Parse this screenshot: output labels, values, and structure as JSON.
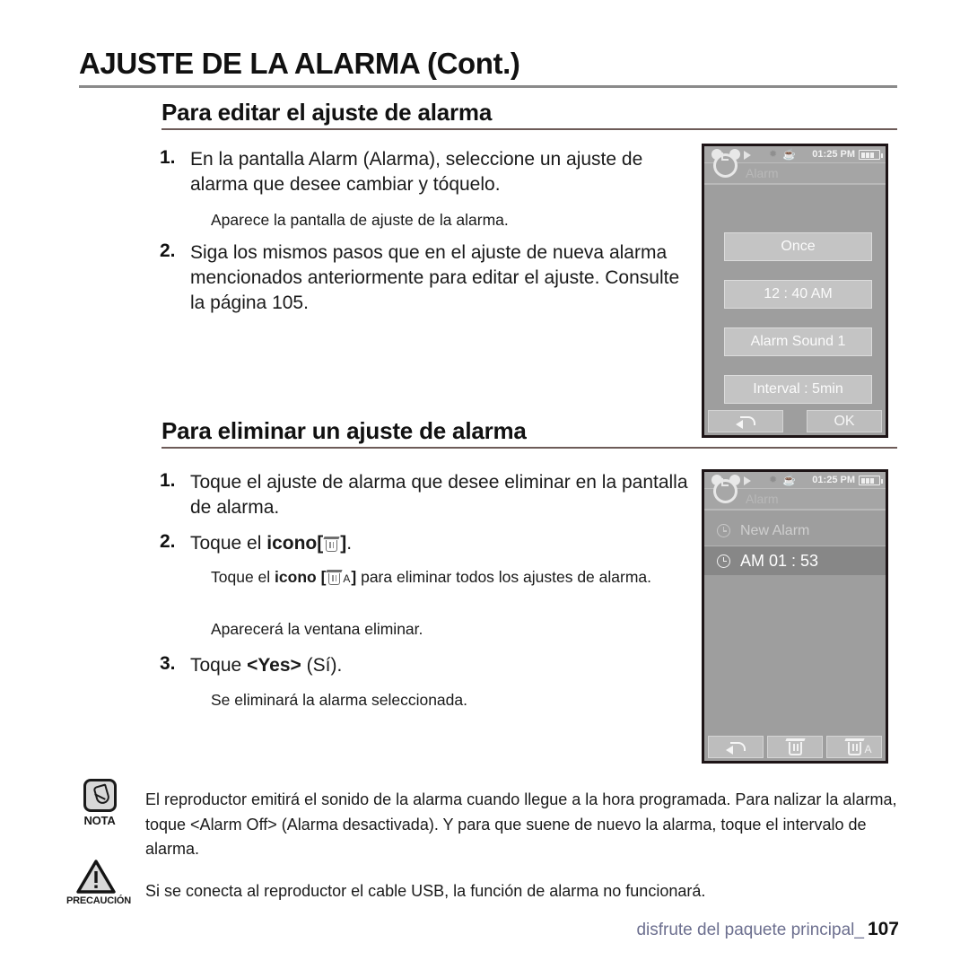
{
  "chapter": {
    "title": "AJUSTE DE LA ALARMA (Cont.)"
  },
  "sections": [
    {
      "heading": "Para editar el ajuste de alarma",
      "steps": [
        {
          "num": "1.",
          "text": "En la pantalla Alarm (Alarma), seleccione un ajuste de alarma que desee cambiar y tóquelo."
        },
        {
          "note": "Aparece la pantalla de ajuste de la alarma."
        },
        {
          "num": "2.",
          "text": "Siga los mismos pasos que en el ajuste de nueva alarma mencionados anteriormente para editar el ajuste. Consulte la página 105."
        }
      ]
    },
    {
      "heading": "Para eliminar un ajuste de alarma",
      "steps": [
        {
          "num": "1.",
          "text": "Toque el ajuste de alarma que desee eliminar en la pantalla de alarma."
        },
        {
          "num": "2.",
          "text_pre": "Toque el ",
          "bold": "icono",
          "bracket_open": "[",
          "bracket_close": "]",
          "text_post": "."
        },
        {
          "note_pre": "Toque el ",
          "note_bold": "icono",
          "note_post": " para eliminar todos los ajustes de alarma."
        },
        {
          "note": "Aparecerá la ventana eliminar."
        },
        {
          "num": "3.",
          "text_pre": "Toque ",
          "bold": "<Yes>",
          "text_post": " (Sí)."
        },
        {
          "note": "Se eliminará la alarma seleccionada."
        }
      ]
    }
  ],
  "device_edit": {
    "statusbar": {
      "time": "01:25 PM",
      "icons": [
        "play-icon",
        "bluetooth-icon",
        "bell-icon",
        "battery-icon"
      ]
    },
    "title": "Alarm",
    "buttons": [
      {
        "label": "Once"
      },
      {
        "label": "12 : 40 AM"
      },
      {
        "label": "Alarm Sound 1"
      },
      {
        "label": "Interval : 5min"
      }
    ],
    "softkeys": [
      {
        "label": "",
        "icon": "back-arrow-icon"
      },
      {
        "label": "OK",
        "icon": ""
      }
    ]
  },
  "device_delete": {
    "statusbar": {
      "time": "01:25 PM",
      "icons": [
        "play-icon",
        "bluetooth-icon",
        "bell-icon",
        "battery-icon"
      ]
    },
    "title": "Alarm",
    "rows": [
      {
        "label": "New Alarm",
        "selected": false
      },
      {
        "label": "AM 01 : 53",
        "selected": true
      }
    ],
    "softkeys": [
      {
        "icon": "back-arrow-icon"
      },
      {
        "icon": "trash-icon"
      },
      {
        "icon": "trash-all-icon"
      }
    ]
  },
  "notes": [
    {
      "icon_label": "NOTA",
      "text": "El reproductor emitirá el sonido de la alarma cuando llegue a la hora programada. Para  nalizar la alarma, toque <Alarm Off> (Alarma desactivada). Y para que suene de nuevo la alarma, toque el intervalo de alarma."
    },
    {
      "icon_label": "PRECAUCIÓN",
      "text": "Si se conecta al reproductor el cable USB, la función de alarma no funcionará."
    }
  ],
  "footer": {
    "text": "disfrute del paquete principal_",
    "page": "107"
  }
}
